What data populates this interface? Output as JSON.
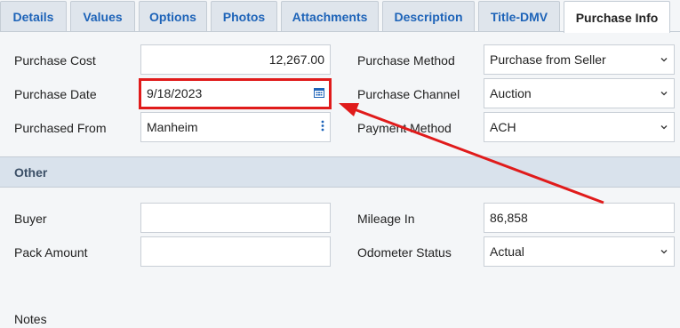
{
  "tabs": [
    {
      "label": "Details"
    },
    {
      "label": "Values"
    },
    {
      "label": "Options"
    },
    {
      "label": "Photos"
    },
    {
      "label": "Attachments"
    },
    {
      "label": "Description"
    },
    {
      "label": "Title-DMV"
    },
    {
      "label": "Purchase Info",
      "active": true
    }
  ],
  "purchase": {
    "cost_label": "Purchase Cost",
    "cost_value": "12,267.00",
    "date_label": "Purchase Date",
    "date_value": "9/18/2023",
    "from_label": "Purchased From",
    "from_value": "Manheim",
    "method_label": "Purchase Method",
    "method_value": "Purchase from Seller",
    "channel_label": "Purchase Channel",
    "channel_value": "Auction",
    "payment_label": "Payment Method",
    "payment_value": "ACH"
  },
  "other": {
    "section_title": "Other",
    "buyer_label": "Buyer",
    "buyer_value": "",
    "pack_label": "Pack Amount",
    "pack_value": "",
    "mileage_label": "Mileage In",
    "mileage_value": "86,858",
    "odometer_label": "Odometer Status",
    "odometer_value": "Actual"
  },
  "notes": {
    "label": "Notes"
  },
  "colors": {
    "accent": "#1d63b8",
    "annotation": "#e01b1b"
  },
  "icons": {
    "date": "calendar-icon",
    "from": "more-vertical-icon",
    "select": "chevron-down-icon"
  }
}
